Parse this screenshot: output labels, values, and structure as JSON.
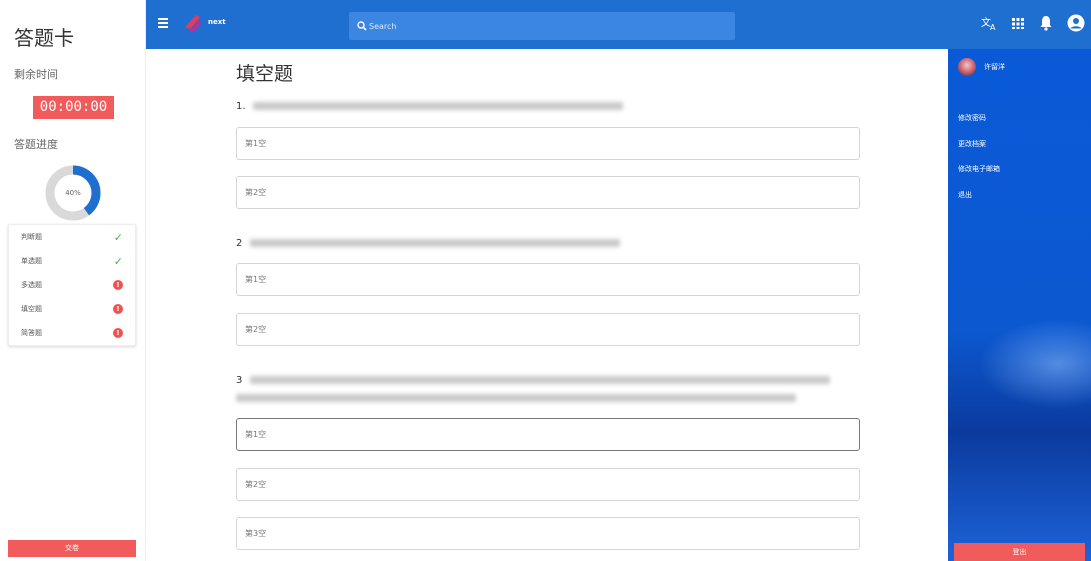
{
  "answer_card": {
    "title": "答题卡",
    "time_label": "剩余时间",
    "timer": "00:00:00",
    "progress_label": "答题进度",
    "progress_percent": 40,
    "progress_text": "40%",
    "question_types": [
      {
        "label": "判断题",
        "status": "done"
      },
      {
        "label": "单选题",
        "status": "done"
      },
      {
        "label": "多选题",
        "status": "incomplete"
      },
      {
        "label": "填空题",
        "status": "incomplete"
      },
      {
        "label": "简答题",
        "status": "incomplete"
      }
    ],
    "submit_label": "交卷",
    "alert_glyph": "!",
    "check_glyph": "✓"
  },
  "appbar": {
    "logo_text": "next",
    "search_placeholder": "Search",
    "icons": [
      "translate-icon",
      "apps-icon",
      "bell-icon",
      "account-icon"
    ]
  },
  "main": {
    "section_title": "填空题",
    "questions": [
      {
        "number": "1.",
        "blanks": [
          "第1空",
          "第2空"
        ]
      },
      {
        "number": "2",
        "blanks": [
          "第1空",
          "第2空"
        ]
      },
      {
        "number": "3",
        "blanks": [
          "第1空",
          "第2空",
          "第3空"
        ]
      }
    ]
  },
  "drawer": {
    "user_name": "许留洋",
    "menu": [
      "修改密码",
      "更改档案",
      "修改电子邮箱",
      "退出"
    ],
    "logout_label": "登出"
  },
  "colors": {
    "primary": "#1e6fcf",
    "danger": "#f15b5b",
    "success": "#4caf50",
    "progress": "#1e6fcf"
  }
}
